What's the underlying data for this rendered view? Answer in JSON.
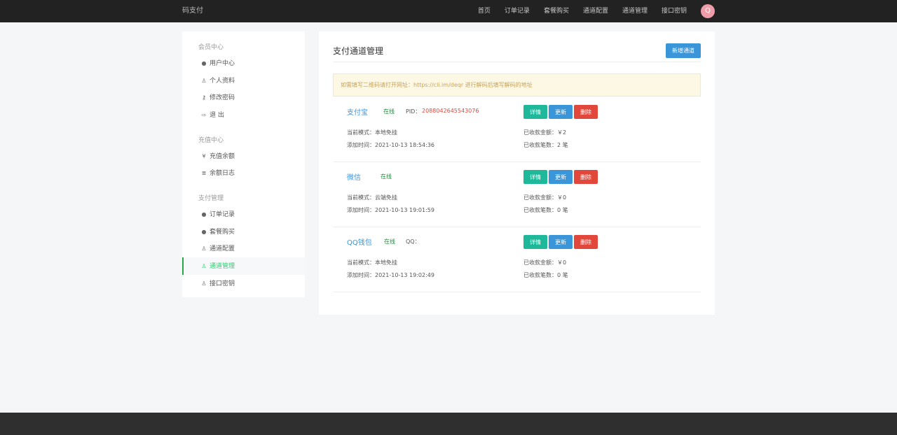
{
  "brand": "码支付",
  "nav": {
    "items": [
      "首页",
      "订单记录",
      "套餐购买",
      "通道配置",
      "通道管理",
      "接口密钥"
    ],
    "avatar": "Q"
  },
  "sidebar": {
    "group1": "会员中心",
    "group2": "充值中心",
    "group3": "支付管理",
    "items": [
      {
        "icon": "user-circle-icon",
        "glyph": "●",
        "label": "用户中心"
      },
      {
        "icon": "user-icon",
        "glyph": "♙",
        "label": "个人资料"
      },
      {
        "icon": "key-icon",
        "glyph": "⚷",
        "label": "修改密码"
      },
      {
        "icon": "logout-icon",
        "glyph": "⇨",
        "label": "退 出"
      },
      {
        "icon": "yen-icon",
        "glyph": "¥",
        "label": "充值余额"
      },
      {
        "icon": "list-icon",
        "glyph": "≣",
        "label": "余额日志"
      },
      {
        "icon": "user-circle-icon",
        "glyph": "●",
        "label": "订单记录"
      },
      {
        "icon": "user-circle-icon",
        "glyph": "●",
        "label": "套餐购买"
      },
      {
        "icon": "user-icon",
        "glyph": "♙",
        "label": "通道配置"
      },
      {
        "icon": "user-icon",
        "glyph": "♙",
        "label": "通道管理"
      },
      {
        "icon": "user-icon",
        "glyph": "♙",
        "label": "接口密钥"
      }
    ],
    "active": "通道管理"
  },
  "main": {
    "title": "支付通道管理",
    "new_button": "新增通道",
    "notice": "如需填写二维码请打开网址：https://cli.im/deqr 进行解码后填写解码的地址",
    "buttons": {
      "detail": "详情",
      "update": "更新",
      "delete": "删除"
    },
    "channels": [
      {
        "name": "支付宝",
        "status": "在线",
        "id_label": "PID：",
        "id_value": "2088042645543076",
        "mode": "当前模式：本地免挂",
        "added": "添加时间：2021-10-13 18:54:36",
        "amount": "已收款金额：￥2",
        "count": "已收款笔数：2 笔"
      },
      {
        "name": "微信",
        "status": "在线",
        "id_label": "",
        "id_value": "",
        "mode": "当前模式：云端免挂",
        "added": "添加时间：2021-10-13 19:01:59",
        "amount": "已收款金额：￥0",
        "count": "已收款笔数：0 笔"
      },
      {
        "name": "QQ钱包",
        "status": "在线",
        "id_label": "QQ：",
        "id_value": "",
        "mode": "当前模式：本地免挂",
        "added": "添加时间：2021-10-13 19:02:49",
        "amount": "已收款金额：￥0",
        "count": "已收款笔数：0 笔"
      }
    ]
  }
}
